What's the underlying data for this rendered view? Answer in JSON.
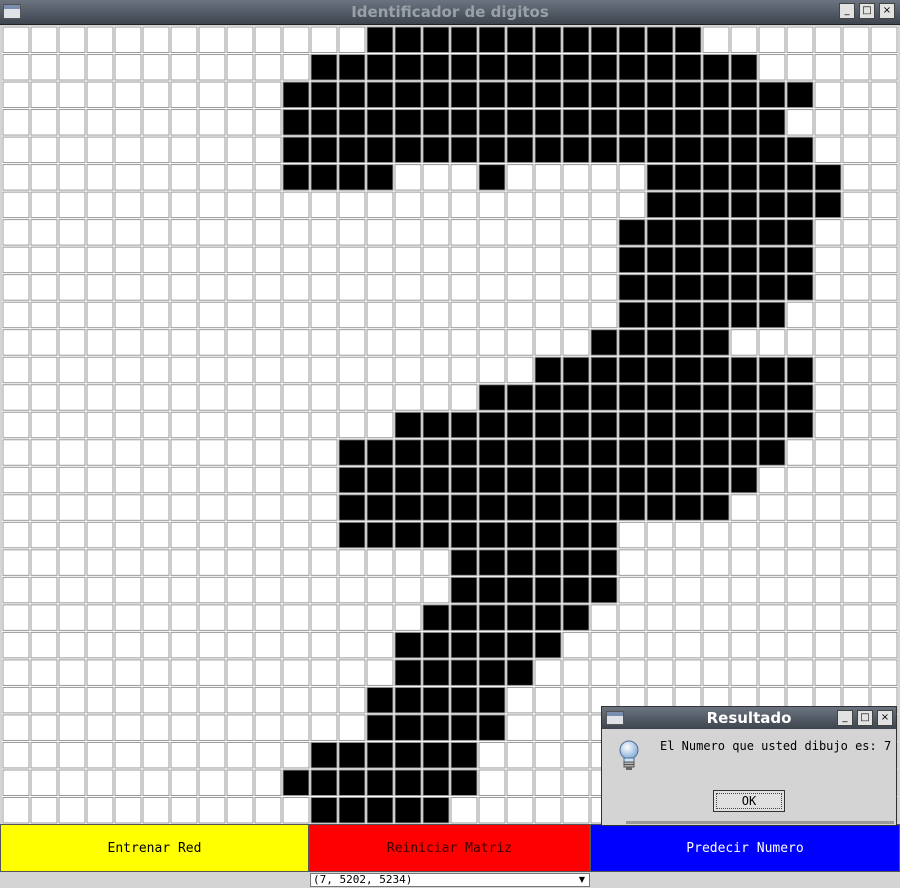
{
  "window": {
    "title": "Identificador de digitos",
    "controls": [
      "_",
      "□",
      "×"
    ]
  },
  "grid": {
    "cols": 32,
    "rows": 29,
    "filled_color": "#000000",
    "empty_color": "#ffffff",
    "line_color": "#9a9a9a",
    "cells": [
      "0000000000000111111111111000000",
      "00000000000111111111111111100000",
      "00000000001111111111111111111000",
      "00000000001111111111111111110000",
      "00000000001111111111111111111000",
      "00000000001111000100000111111100",
      "00000000000000000000000111111100",
      "00000000000000000000001111111000",
      "00000000000000000000001111111000",
      "00000000000000000000001111111000",
      "00000000000000000000001111110000",
      "00000000000000000000011111000000",
      "00000000000000000001111111111000",
      "00000000000000000111111111111000",
      "00000000000000111111111111111000",
      "00000000000011111111111111110000",
      "00000000000011111111111111100000",
      "00000000000011111111111111000000",
      "00000000000011111111110000000000",
      "00000000000000001111110000000000",
      "00000000000000001111110000000000",
      "00000000000000011111100000000000",
      "00000000000000111111000000000000",
      "00000000000000111110000000000000",
      "00000000000001111100000000000000",
      "00000000000001111100000000000000",
      "00000000000111111000000000000000",
      "00000000001111111000000000000000",
      "00000000000111110000000000000000"
    ]
  },
  "buttons": {
    "train": {
      "label": "Entrenar Red",
      "color": "#ffff00"
    },
    "reset": {
      "label": "Reiniciar Matriz",
      "color": "#ff0000"
    },
    "predict": {
      "label": "Predecir Numero",
      "color": "#0000ff"
    }
  },
  "status": {
    "combo_value": "(7, 5202, 5234)"
  },
  "dialog": {
    "title": "Resultado",
    "message": "El Numero que usted dibujo es: 7",
    "ok_label": "OK",
    "icon": "lightbulb-icon"
  }
}
